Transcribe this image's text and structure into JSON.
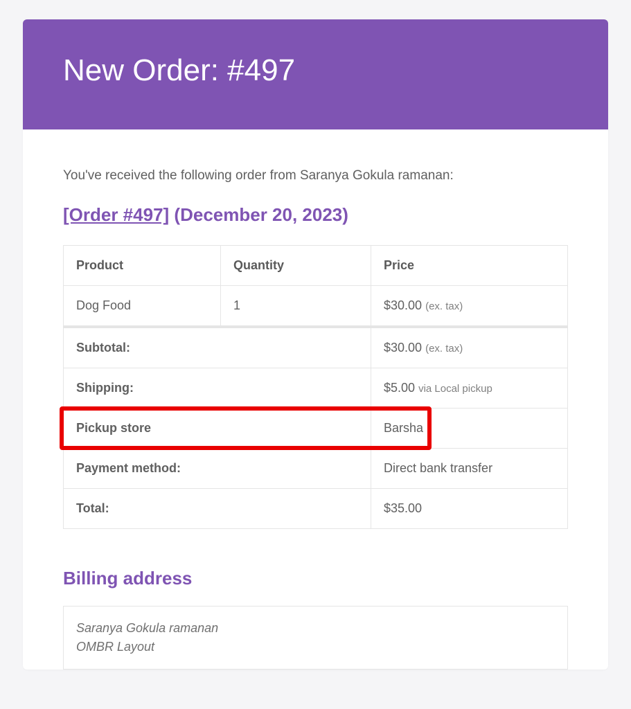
{
  "header": {
    "title": "New Order: #497"
  },
  "intro": "You've received the following order from Saranya Gokula ramanan:",
  "order_link": {
    "text": "[Order #497]",
    "date": "(December 20, 2023)"
  },
  "table": {
    "headers": {
      "product": "Product",
      "quantity": "Quantity",
      "price": "Price"
    },
    "items": [
      {
        "product": "Dog Food",
        "quantity": "1",
        "price": "$30.00",
        "price_note": "(ex. tax)"
      }
    ],
    "totals": {
      "subtotal": {
        "label": "Subtotal:",
        "value": "$30.00",
        "note": "(ex. tax)"
      },
      "shipping": {
        "label": "Shipping:",
        "value": "$5.00",
        "note": "via Local pickup"
      },
      "pickup_store": {
        "label": "Pickup store",
        "value": "Barsha"
      },
      "payment_method": {
        "label": "Payment method:",
        "value": "Direct bank transfer"
      },
      "total": {
        "label": "Total:",
        "value": "$35.00"
      }
    }
  },
  "billing": {
    "title": "Billing address",
    "lines": [
      "Saranya Gokula ramanan",
      "OMBR Layout"
    ]
  }
}
